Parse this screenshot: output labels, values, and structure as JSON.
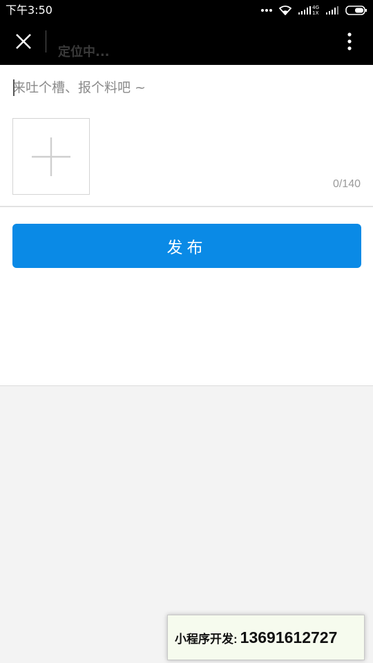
{
  "status_bar": {
    "time": "下午3:50",
    "network_label_top": "4G",
    "network_label_bottom": "1X",
    "icons": [
      "more-dots-icon",
      "wifi-icon",
      "signal-4g-icon",
      "signal-icon",
      "battery-icon"
    ]
  },
  "title_bar": {
    "title": "定位中...",
    "close_icon": "close-icon",
    "more_icon": "vertical-dots-icon"
  },
  "compose": {
    "placeholder": "来吐个槽、报个料吧 ~",
    "value": "",
    "char_count": "0/140",
    "add_photo_icon": "plus-icon"
  },
  "actions": {
    "publish_label": "发布"
  },
  "promo": {
    "label": "小程序开发:",
    "phone": "13691612727"
  },
  "colors": {
    "primary": "#0a8ae6",
    "header": "#000000",
    "page_bg": "#f3f3f3"
  }
}
